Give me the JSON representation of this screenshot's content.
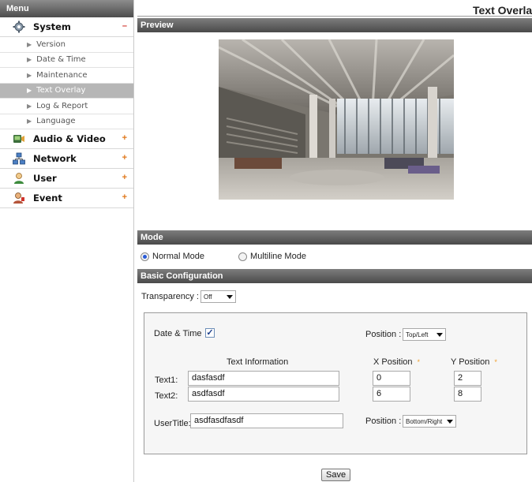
{
  "sidebar": {
    "header": "Menu",
    "system": {
      "label": "System",
      "sign": "–",
      "icon": "gear-icon"
    },
    "system_items": [
      {
        "label": "Version"
      },
      {
        "label": "Date & Time"
      },
      {
        "label": "Maintenance"
      },
      {
        "label": "Text Overlay",
        "active": true
      },
      {
        "label": "Log & Report"
      },
      {
        "label": "Language"
      }
    ],
    "categories": [
      {
        "label": "Audio & Video",
        "sign": "+",
        "icon": "audio-video-icon"
      },
      {
        "label": "Network",
        "sign": "+",
        "icon": "network-icon"
      },
      {
        "label": "User",
        "sign": "+",
        "icon": "user-icon"
      },
      {
        "label": "Event",
        "sign": "+",
        "icon": "event-icon"
      }
    ]
  },
  "page": {
    "title": "Text Overlay"
  },
  "sections": {
    "preview": "Preview",
    "mode": "Mode",
    "basic": "Basic Configuration"
  },
  "mode": {
    "normal_label": "Normal Mode",
    "multiline_label": "Multiline Mode",
    "selected": "normal"
  },
  "basic": {
    "transparency_label": "Transparency :",
    "transparency_value": "Off",
    "date_time_label": "Date & Time",
    "date_time_checked": true,
    "position_label": "Position :",
    "position1_value": "Top/Left",
    "text_info_header": "Text Information",
    "x_header": "X Position",
    "y_header": "Y Position",
    "required_mark": "*",
    "text1_label": "Text1:",
    "text1_value": "dasfasdf",
    "text1_x": "0",
    "text1_y": "2",
    "text2_label": "Text2:",
    "text2_value": "asdfasdf",
    "text2_x": "6",
    "text2_y": "8",
    "usertitle_label": "UserTitle:",
    "usertitle_value": "asdfasdfasdf",
    "position2_value": "Bottom/Right"
  },
  "save_label": "Save",
  "colors": {
    "section_bar": "#4a4a4a",
    "active_menu": "#b6b6b6",
    "plus_sign": "#e0781b",
    "minus_sign": "#d0342c"
  }
}
